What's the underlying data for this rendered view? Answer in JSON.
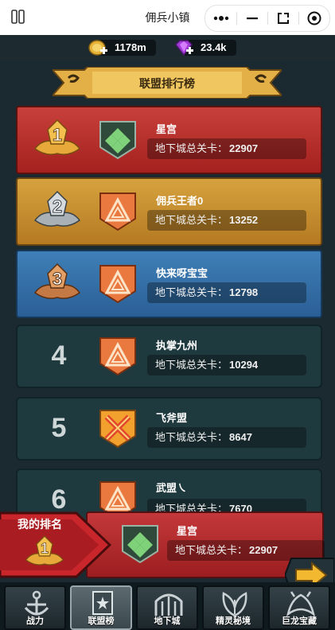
{
  "app": {
    "title": "佣兵小镇"
  },
  "currency": {
    "gold": "1178m",
    "gems": "23.4k"
  },
  "banner": {
    "title": "联盟排行榜"
  },
  "stat_label": "地下城总关卡：",
  "rows": [
    {
      "rank": "1",
      "name": "星宫",
      "score": "22907",
      "emblem": "green-diamond-emblem"
    },
    {
      "rank": "2",
      "name": "佣兵王者0",
      "score": "13252",
      "emblem": "orange-triangle-emblem"
    },
    {
      "rank": "3",
      "name": "快来呀宝宝",
      "score": "12798",
      "emblem": "orange-triangle-emblem"
    },
    {
      "rank": "4",
      "name": "执掌九州",
      "score": "10294",
      "emblem": "orange-triangle-emblem"
    },
    {
      "rank": "5",
      "name": "飞斧盟",
      "score": "8647",
      "emblem": "crossed-axes-emblem"
    },
    {
      "rank": "6",
      "name": "武盟㇏",
      "score": "7670",
      "emblem": "orange-triangle-emblem"
    }
  ],
  "my_rank": {
    "label": "我的排名",
    "rank": "1",
    "name": "星宫",
    "score": "22907"
  },
  "tabs": [
    {
      "label": "战力",
      "icon": "anchor-icon"
    },
    {
      "label": "联盟榜",
      "icon": "banner-icon"
    },
    {
      "label": "地下城",
      "icon": "gate-icon"
    },
    {
      "label": "精灵秘境",
      "icon": "leaf-icon"
    },
    {
      "label": "巨龙宝藏",
      "icon": "dragon-icon"
    }
  ],
  "colors": {
    "gold": "#e8b23a",
    "red": "#b42a26",
    "blue": "#3a74ae",
    "dark": "#1f3a3f"
  }
}
